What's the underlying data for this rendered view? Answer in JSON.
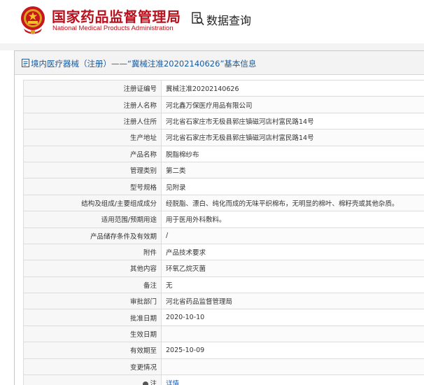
{
  "site": {
    "name_cn": "国家药品监督管理局",
    "name_en": "National Medical Products Administration",
    "query_label": "数据查询"
  },
  "panel": {
    "title": "境内医疗器械（注册）——“冀械注准20202140626”基本信息"
  },
  "rows": [
    {
      "label": "注册证编号",
      "value": "冀械注准20202140626"
    },
    {
      "label": "注册人名称",
      "value": "河北鑫万保医疗用品有限公司"
    },
    {
      "label": "注册人住所",
      "value": "河北省石家庄市无极县郭庄镇磁河店村富民路14号"
    },
    {
      "label": "生产地址",
      "value": "河北省石家庄市无极县郭庄镇磁河店村富民路14号"
    },
    {
      "label": "产品名称",
      "value": "脱脂棉纱布"
    },
    {
      "label": "管理类别",
      "value": "第二类"
    },
    {
      "label": "型号规格",
      "value": "见附录"
    },
    {
      "label": "结构及组成/主要组成成分",
      "value": "经脱脂、漂白、纯化而成的无味平织棉布，无明显的棉叶、棉籽壳或其他杂质。"
    },
    {
      "label": "适用范围/预期用途",
      "value": "用于医用外科敷料。"
    },
    {
      "label": "产品储存条件及有效期",
      "value": "/"
    },
    {
      "label": "附件",
      "value": "产品技术要求"
    },
    {
      "label": "其他内容",
      "value": "环氧乙烷灭菌"
    },
    {
      "label": "备注",
      "value": "无"
    },
    {
      "label": "审批部门",
      "value": "河北省药品监督管理局"
    },
    {
      "label": "批准日期",
      "value": "2020-10-10"
    },
    {
      "label": "生效日期",
      "value": ""
    },
    {
      "label": "有效期至",
      "value": "2025-10-09"
    },
    {
      "label": "变更情况",
      "value": ""
    },
    {
      "label": "注",
      "value": "详情"
    }
  ],
  "colors": {
    "brand_red": "#b8111d",
    "title_blue": "#1a5a9e",
    "link_blue": "#1e5fb3"
  },
  "icons": {
    "emblem": "national-emblem-icon",
    "query": "search-document-icon",
    "title": "document-icon",
    "note": "lightbulb-icon"
  }
}
